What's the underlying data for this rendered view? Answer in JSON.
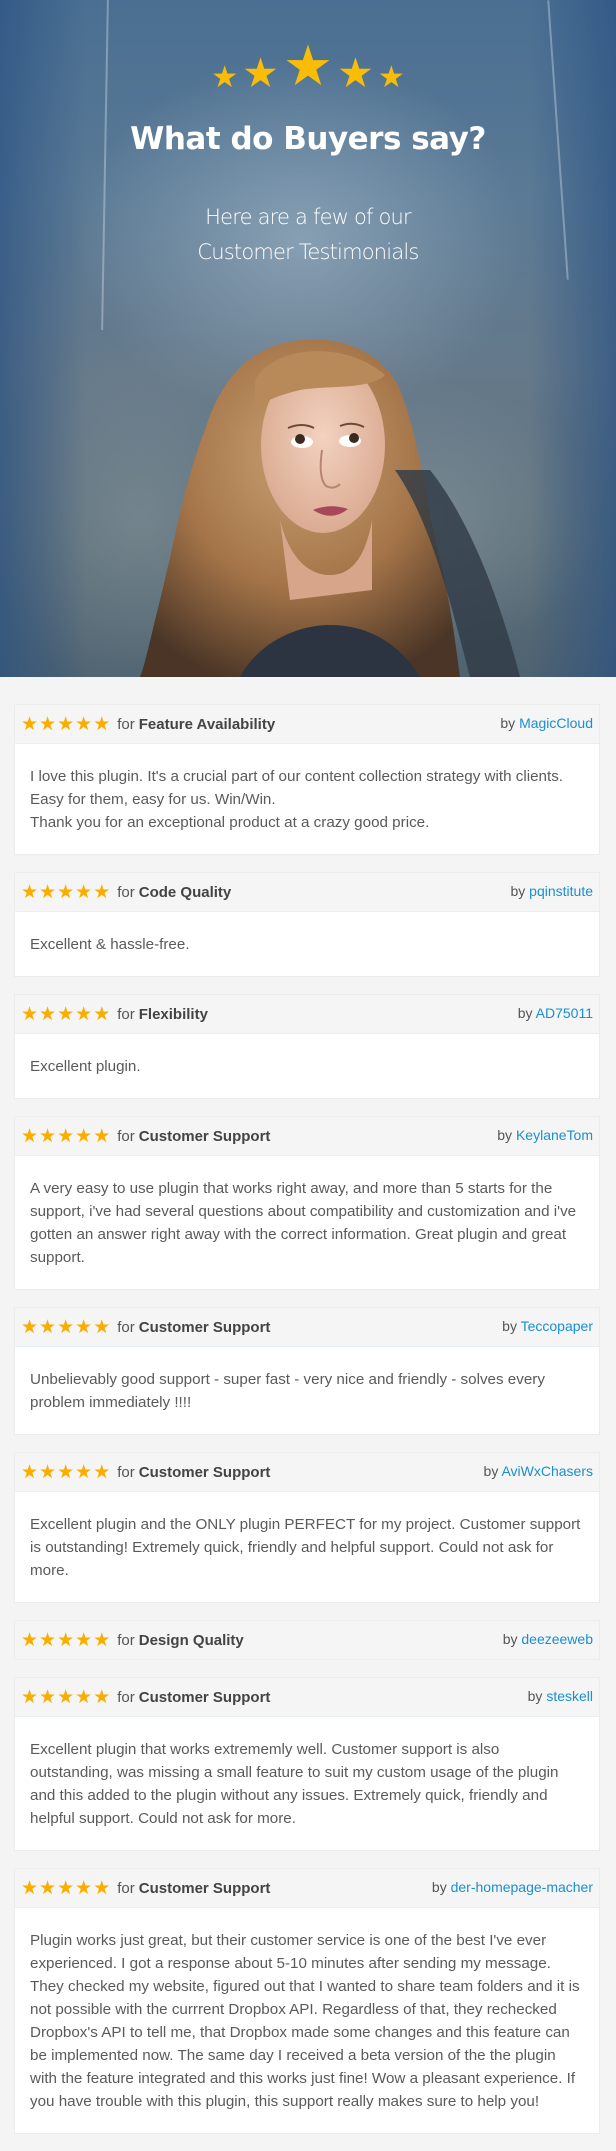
{
  "hero": {
    "rating_stars": [
      "star-small",
      "star-medium",
      "star-large",
      "star-medium",
      "star-small"
    ],
    "title": "What do Buyers say?",
    "subtitle_line1": "Here are a few of our",
    "subtitle_line2": "Customer Testimonials"
  },
  "colors": {
    "star": "#f9ad00",
    "hero_star": "#f9bd07",
    "author_link": "#1a8fd0",
    "text": "#5a5a5a",
    "card_header_bg": "#f5f5f5",
    "page_bg": "#f4f4f4"
  },
  "reviews": [
    {
      "stars": 5,
      "for_label": "for",
      "category": "Feature Availability",
      "by_label": "by",
      "author": "MagicCloud",
      "lines": [
        "I love this plugin. It's a crucial part of our content collection strategy with clients. Easy for them, easy for us. Win/Win.",
        "Thank you for an exceptional product at a crazy good price."
      ]
    },
    {
      "stars": 5,
      "for_label": "for",
      "category": "Code Quality",
      "by_label": "by",
      "author": "pqinstitute",
      "lines": [
        "Excellent & hassle-free."
      ]
    },
    {
      "stars": 5,
      "for_label": "for",
      "category": "Flexibility",
      "by_label": "by",
      "author": "AD75011",
      "lines": [
        "Excellent plugin."
      ]
    },
    {
      "stars": 5,
      "for_label": "for",
      "category": "Customer Support",
      "by_label": "by",
      "author": "KeylaneTom",
      "lines": [
        "A very easy to use plugin that works right away, and more than 5 starts for the support, i've had several questions about compatibility and customization and i've gotten an answer right away with the correct information. Great plugin and great support."
      ]
    },
    {
      "stars": 5,
      "for_label": "for",
      "category": "Customer Support",
      "by_label": "by",
      "author": "Teccopaper",
      "lines": [
        "Unbelievably good support - super fast - very nice and friendly - solves every problem immediately !!!!"
      ]
    },
    {
      "stars": 5,
      "for_label": "for",
      "category": "Customer Support",
      "by_label": "by",
      "author": "AviWxChasers",
      "lines": [
        "Excellent plugin and the ONLY plugin PERFECT for my project. Customer support is outstanding! Extremely quick, friendly and helpful support. Could not ask for more."
      ]
    },
    {
      "stars": 5,
      "for_label": "for",
      "category": "Design Quality",
      "by_label": "by",
      "author": "deezeeweb",
      "lines": []
    },
    {
      "stars": 5,
      "for_label": "for",
      "category": "Customer Support",
      "by_label": "by",
      "author": "steskell",
      "lines": [
        "Excellent plugin that works extrememly well. Customer support is also outstanding, was missing a small feature to suit my custom usage of the plugin and this added to the plugin without any issues. Extremely quick, friendly and helpful support. Could not ask for more."
      ]
    },
    {
      "stars": 5,
      "for_label": "for",
      "category": "Customer Support",
      "by_label": "by",
      "author": "der-homepage-macher",
      "lines": [
        "Plugin works just great, but their customer service is one of the best I've ever experienced. I got a response about 5-10 minutes after sending my message. They checked my website, figured out that I wanted to share team folders and it is not possible with the currrent Dropbox API. Regardless of that, they rechecked Dropbox's API to tell me, that Dropbox made some changes and this feature can be implemented now. The same day I received a beta version of the the plugin with the feature integrated and this works just fine! Wow a pleasant experience. If you have trouble with this plugin, this support really makes sure to help you!"
      ]
    }
  ]
}
